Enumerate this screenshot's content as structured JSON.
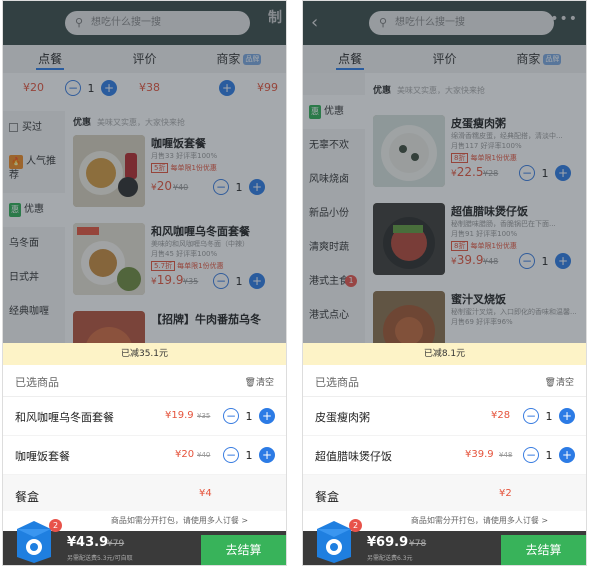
{
  "left": {
    "search_placeholder": "想吃什么搜一搜",
    "shop_mark": "制",
    "tabs": [
      "点餐",
      "评价",
      "商家"
    ],
    "tab_badge": "品牌",
    "top_strip": {
      "price1": "¥20",
      "qty1": "1",
      "price2": "¥38",
      "price3": "¥99"
    },
    "sidebar": [
      "买过",
      "人气推荐",
      "优惠",
      "乌冬面",
      "日式丼",
      "经典咖喱"
    ],
    "promo_label": "优惠",
    "promo_sub": "美味又实惠，大家快来抢",
    "dishes": [
      {
        "name": "咖喱饭套餐",
        "desc": "月售33 好评率100%",
        "sales": "5折 每单限1份优惠",
        "limit_tag": "5折",
        "limit_text": "每单限1份优惠",
        "price": "20",
        "old": "¥40",
        "qty": "1"
      },
      {
        "name": "和风咖喱乌冬面套餐",
        "desc": "美味的和风咖喱乌冬面（中辣）",
        "sales": "月售45 好评率100%",
        "limit_tag": "5.7折",
        "limit_text": "每单限1份优惠",
        "price": "19.9",
        "old": "¥35",
        "qty": "1"
      },
      {
        "name": "【招牌】牛肉番茄乌冬",
        "desc": "",
        "sales": "",
        "limit_tag": "",
        "limit_text": "",
        "price": "",
        "old": "",
        "qty": ""
      }
    ],
    "savings": "已减35.1元",
    "cart_title": "已选商品",
    "clear": "清空",
    "cart_items": [
      {
        "name": "和风咖喱乌冬面套餐",
        "price": "¥19.9",
        "old": "¥35",
        "qty": "1"
      },
      {
        "name": "咖喱饭套餐",
        "price": "¥20",
        "old": "¥40",
        "qty": "1"
      }
    ],
    "box_label": "餐盒",
    "box_value": "¥4",
    "pack_note": "商品如需分开打包，请使用多人订餐 >",
    "total": "¥43.9",
    "total_old": "¥79",
    "fee": "另需配送费5.3元/可自取",
    "cart_count": "2",
    "checkout": "去结算"
  },
  "right": {
    "search_placeholder": "想吃什么搜一搜",
    "tabs": [
      "点餐",
      "评价",
      "商家"
    ],
    "tab_badge": "品牌",
    "sidebar": [
      "优惠",
      "无辜不欢",
      "风味烧卤",
      "新品小份",
      "清爽时蔬",
      "港式主食",
      "港式点心"
    ],
    "sidebar_badge": "1",
    "promo_label": "优惠",
    "promo_sub": "美味又实惠，大家快来抢",
    "dishes": [
      {
        "name": "皮蛋瘦肉粥",
        "desc": "绵滑香糯皮蛋，经典配搭，清淡中...",
        "sales": "月售117 好评率100%",
        "limit_tag": "8折",
        "limit_text": "每单限1份优惠",
        "price": "22.5",
        "old": "¥28",
        "qty": "1"
      },
      {
        "name": "超值腊味煲仔饭",
        "desc": "秘制腊味腊肠，香脆锅巴在下面...",
        "sales": "月售91 好评率100%",
        "limit_tag": "8折",
        "limit_text": "每单限1份优惠",
        "price": "39.9",
        "old": "¥48",
        "qty": "1"
      },
      {
        "name": "蜜汁叉烧饭",
        "desc": "秘制蜜汁叉烧，入口即化的香味和温馨...",
        "sales": "月售69 好评率96%",
        "limit_tag": "",
        "limit_text": "",
        "price": "",
        "old": "",
        "qty": ""
      }
    ],
    "savings": "已减8.1元",
    "cart_title": "已选商品",
    "clear": "清空",
    "cart_items": [
      {
        "name": "皮蛋瘦肉粥",
        "price": "¥28",
        "old": "",
        "qty": "1"
      },
      {
        "name": "超值腊味煲仔饭",
        "price": "¥39.9",
        "old": "¥48",
        "qty": "1"
      }
    ],
    "box_label": "餐盒",
    "box_value": "¥2",
    "pack_note": "商品如需分开打包，请使用多人订餐 >",
    "total": "¥69.9",
    "total_old": "¥78",
    "fee": "另需配送费6.3元",
    "cart_count": "2",
    "checkout": "去结算"
  },
  "colors": {
    "accent_blue": "#2c7be5",
    "price_red": "#e5533b",
    "checkout_green": "#38b35a",
    "savings_bg": "#fdf3c7"
  }
}
